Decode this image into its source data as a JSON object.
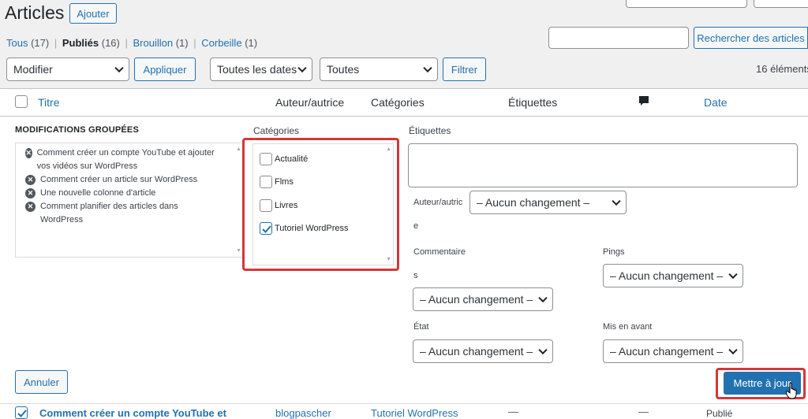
{
  "header": {
    "title": "Articles",
    "add_button": "Ajouter"
  },
  "filters": {
    "all": "Tous",
    "all_count": "(17)",
    "published": "Publiés",
    "published_count": "(16)",
    "draft": "Brouillon",
    "draft_count": "(1)",
    "trash": "Corbeille",
    "trash_count": "(1)",
    "sep": "|"
  },
  "search": {
    "button": "Rechercher des articles",
    "value": ""
  },
  "toolbar": {
    "bulk_action": "Modifier",
    "apply": "Appliquer",
    "dates": "Toutes les dates",
    "categories": "Toutes",
    "filter": "Filtrer",
    "count": "16 éléments"
  },
  "columns": {
    "title": "Titre",
    "author": "Auteur/autrice",
    "categories": "Catégories",
    "tags": "Étiquettes",
    "date": "Date"
  },
  "bulk_edit": {
    "heading": "MODIFICATIONS GROUPÉES",
    "posts": [
      "Comment créer un compte YouTube et ajouter vos vidéos sur WordPress",
      "Comment créer un article sur WordPress",
      "Une nouvelle colonne d'article",
      "Comment planifier des articles dans WordPress"
    ],
    "categories_label": "Catégories",
    "categories": [
      {
        "label": "Actualité",
        "checked": false
      },
      {
        "label": "Flms",
        "checked": false
      },
      {
        "label": "Livres",
        "checked": false
      },
      {
        "label": "Tutoriel WordPress",
        "checked": true
      }
    ],
    "tags_label": "Étiquettes",
    "author_label_1": "Auteur/autric",
    "author_label_2": "e",
    "author_value": "– Aucun changement –",
    "comments_label_1": "Commentaire",
    "comments_label_2": "s",
    "comments_value": "– Aucun changement –",
    "pings_label": "Pings",
    "pings_value": "– Aucun changement –",
    "status_label": "État",
    "status_value": "– Aucun changement –",
    "sticky_label": "Mis en avant",
    "sticky_value": "– Aucun changement –",
    "cancel": "Annuler",
    "update": "Mettre à jour"
  },
  "row": {
    "title": "Comment créer un compte YouTube et",
    "author": "blogpascher",
    "category": "Tutoriel WordPress",
    "tags": "—",
    "comments": "—",
    "status": "Publié"
  },
  "colors": {
    "accent": "#2271b1",
    "primary": "#2271b1",
    "highlight": "#d63638"
  }
}
